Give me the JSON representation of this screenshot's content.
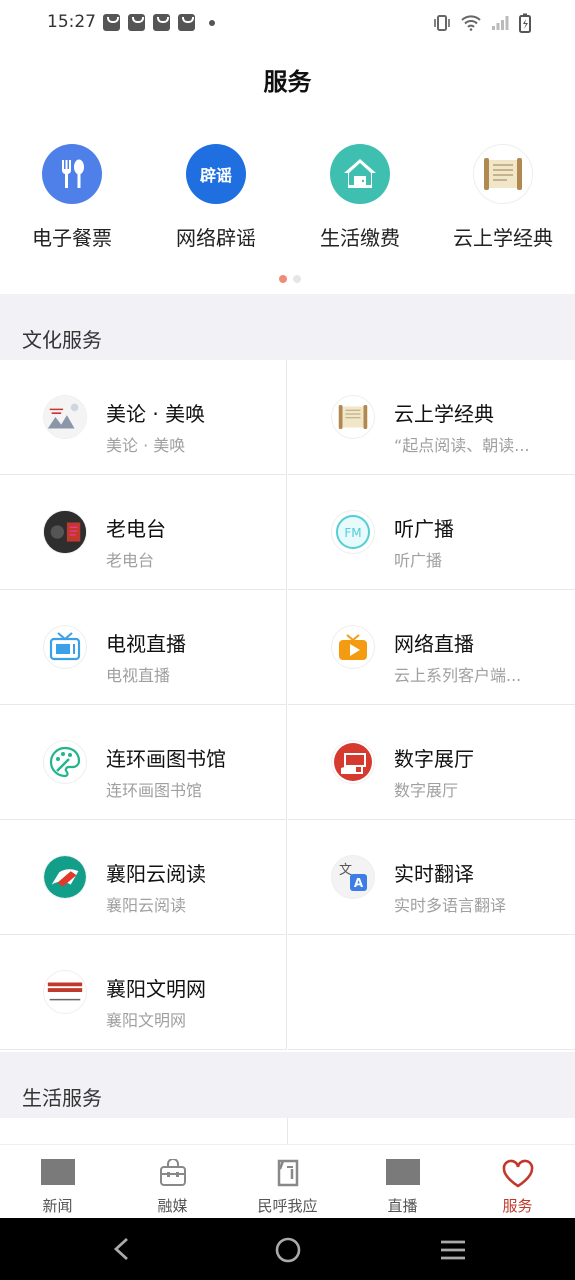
{
  "status": {
    "time": "15:27"
  },
  "header": {
    "title": "服务"
  },
  "quick": [
    {
      "label": "电子餐票",
      "icon": "fork-spoon-icon",
      "color": "#4f7fe8"
    },
    {
      "label": "网络辟谣",
      "icon": "rumor-badge-icon",
      "color": "#1f6fe0",
      "badge": "辟谣"
    },
    {
      "label": "生活缴费",
      "icon": "house-icon",
      "color": "#3fbfb0"
    },
    {
      "label": "云上学经典",
      "icon": "scroll-icon",
      "color": "#c9a96a"
    }
  ],
  "sections": {
    "culture": "文化服务",
    "life": "生活服务"
  },
  "culture_items": [
    {
      "title": "美论 · 美唤",
      "sub": "美论 · 美唤",
      "icon": "painting-thumb-icon"
    },
    {
      "title": "云上学经典",
      "sub": "“起点阅读、朝读...",
      "icon": "scroll-icon"
    },
    {
      "title": "老电台",
      "sub": "老电台",
      "icon": "radio-thumb-icon"
    },
    {
      "title": "听广播",
      "sub": "听广播",
      "icon": "fm-icon"
    },
    {
      "title": "电视直播",
      "sub": "电视直播",
      "icon": "tv-icon"
    },
    {
      "title": "网络直播",
      "sub": "云上系列客户端...",
      "icon": "play-icon"
    },
    {
      "title": "连环画图书馆",
      "sub": "连环画图书馆",
      "icon": "palette-icon"
    },
    {
      "title": "数字展厅",
      "sub": "数字展厅",
      "icon": "exhibit-icon"
    },
    {
      "title": "襄阳云阅读",
      "sub": "襄阳云阅读",
      "icon": "reading-icon"
    },
    {
      "title": "实时翻译",
      "sub": "实时多语言翻译",
      "icon": "translate-icon"
    },
    {
      "title": "襄阳文明网",
      "sub": "襄阳文明网",
      "icon": "civilization-icon"
    }
  ],
  "nav": [
    {
      "label": "新闻",
      "icon": "news-icon"
    },
    {
      "label": "融媒",
      "icon": "media-bag-icon"
    },
    {
      "label": "民呼我应",
      "icon": "ask-icon"
    },
    {
      "label": "直播",
      "icon": "live-icon"
    },
    {
      "label": "服务",
      "icon": "heart-icon",
      "active": true
    }
  ],
  "colors": {
    "accent": "#c0392b",
    "band": "#f2f2f6"
  }
}
